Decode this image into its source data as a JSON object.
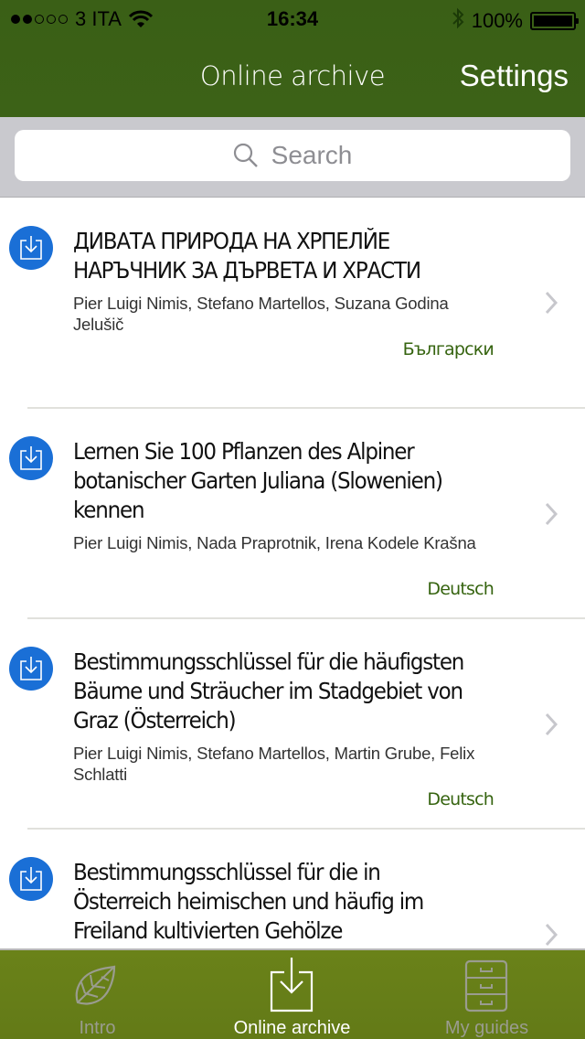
{
  "status_bar": {
    "signal_filled": 2,
    "signal_total": 5,
    "carrier": "3 ITA",
    "wifi_icon": "wifi-icon",
    "time": "16:34",
    "bluetooth_icon": "bluetooth-icon",
    "battery_percent": "100%",
    "battery_level": 1.0
  },
  "nav": {
    "title": "Online archive",
    "settings_label": "Settings"
  },
  "search": {
    "placeholder": "Search",
    "icon": "search-icon"
  },
  "colors": {
    "nav_green": "#3b6017",
    "tab_green": "#678019",
    "accent_blue": "#1a6fd6",
    "language_green": "#366410"
  },
  "guides": [
    {
      "title_lines": [
        "ДИВАТА ПРИРОДА НА ХРПЕЛЙЕ",
        "НАРЪЧНИК ЗА ДЪРВЕТА И ХРАСТИ"
      ],
      "authors": "Pier Luigi Nimis, Stefano Martellos, Suzana Godina Jelušič",
      "language": "Български",
      "icon": "download-icon"
    },
    {
      "title_lines": [
        "Lernen Sie 100 Pflanzen  des Alpiner",
        "botanischer Garten Juliana (Slowenien)",
        "kennen"
      ],
      "authors": "Pier Luigi Nimis, Nada Praprotnik, Irena Kodele Krašna",
      "language": "Deutsch",
      "icon": "download-icon"
    },
    {
      "title_lines": [
        "Bestimmungsschlüssel für die häufigsten",
        "Bäume und Sträucher im Stadgebiet von",
        "Graz (Österreich)"
      ],
      "authors": "Pier Luigi Nimis, Stefano Martellos, Martin Grube, Felix Schlatti",
      "language": "Deutsch",
      "icon": "download-icon"
    },
    {
      "title_lines": [
        "Bestimmungsschlüssel für die in",
        "Österreich  heimischen und häufig im",
        "Freiland kultivierten Gehölze"
      ],
      "authors": "",
      "language": "",
      "icon": "download-icon"
    }
  ],
  "tabs": [
    {
      "label": "Intro",
      "icon": "leaf-icon",
      "active": false
    },
    {
      "label": "Online archive",
      "icon": "download-tray-icon",
      "active": true
    },
    {
      "label": "My guides",
      "icon": "file-cabinet-icon",
      "active": false
    }
  ]
}
